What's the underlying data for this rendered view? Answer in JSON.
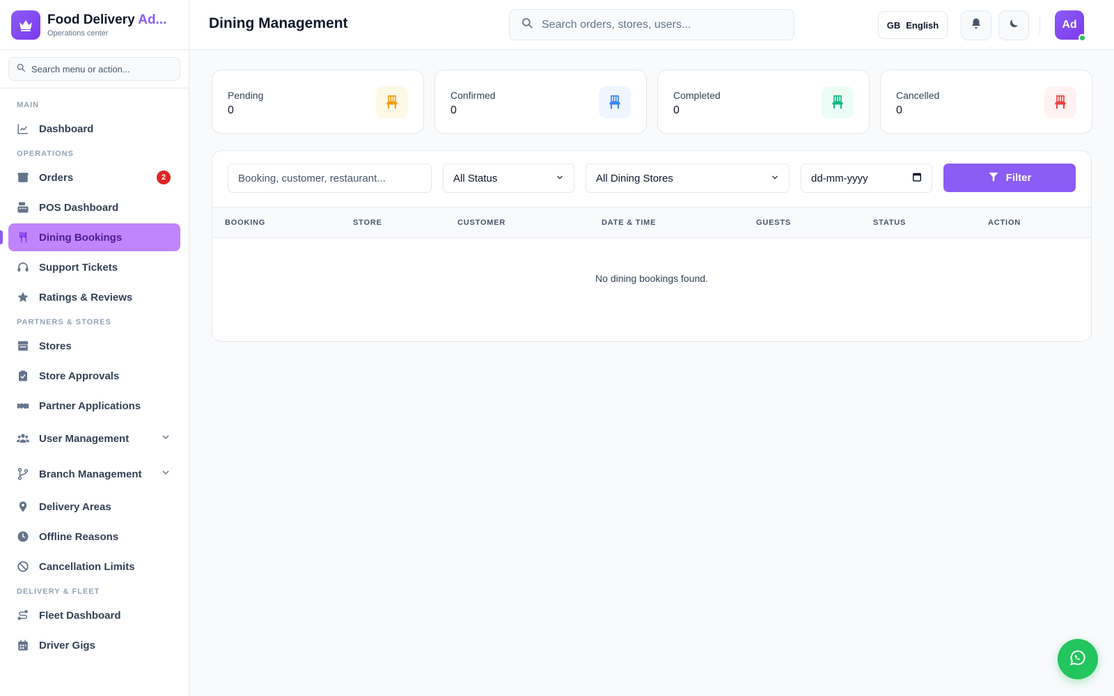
{
  "brand": {
    "title_main": "Food Delivery",
    "title_accent": "Ad...",
    "subtitle": "Operations center"
  },
  "sidebar": {
    "search_placeholder": "Search menu or action...",
    "sections": {
      "main": "MAIN",
      "operations": "OPERATIONS",
      "partners": "PARTNERS & STORES",
      "delivery": "DELIVERY & FLEET"
    },
    "items": {
      "dashboard": "Dashboard",
      "orders": "Orders",
      "orders_badge": "2",
      "pos": "POS Dashboard",
      "dining": "Dining Bookings",
      "support": "Support Tickets",
      "ratings": "Ratings & Reviews",
      "stores": "Stores",
      "store_approvals": "Store Approvals",
      "partner_apps": "Partner Applications",
      "user_mgmt": "User Management",
      "branch_mgmt": "Branch Management",
      "delivery_areas": "Delivery Areas",
      "offline_reasons": "Offline Reasons",
      "cancellation": "Cancellation Limits",
      "fleet": "Fleet Dashboard",
      "gigs": "Driver Gigs"
    }
  },
  "header": {
    "title": "Dining Management",
    "search_placeholder": "Search orders, stores, users...",
    "lang_code": "GB",
    "lang_label": "English",
    "avatar": "Ad"
  },
  "stats": [
    {
      "label": "Pending",
      "value": "0",
      "color": "#f59e0b",
      "bg": "#fef9e7"
    },
    {
      "label": "Confirmed",
      "value": "0",
      "color": "#3b82f6",
      "bg": "#eff6ff"
    },
    {
      "label": "Completed",
      "value": "0",
      "color": "#10b981",
      "bg": "#ecfdf5"
    },
    {
      "label": "Cancelled",
      "value": "0",
      "color": "#ef4444",
      "bg": "#fef2f2"
    }
  ],
  "filters": {
    "search_placeholder": "Booking, customer, restaurant...",
    "status": "All Status",
    "store": "All Dining Stores",
    "date_placeholder": "dd-mm-yyyy",
    "button": "Filter"
  },
  "table": {
    "columns": [
      "BOOKING",
      "STORE",
      "CUSTOMER",
      "DATE & TIME",
      "GUESTS",
      "STATUS",
      "ACTION"
    ],
    "empty": "No dining bookings found."
  },
  "colors": {
    "accent": "#8b5cf6",
    "active_bg": "#c084fc",
    "badge": "#dc2626",
    "whatsapp": "#22c55e"
  }
}
